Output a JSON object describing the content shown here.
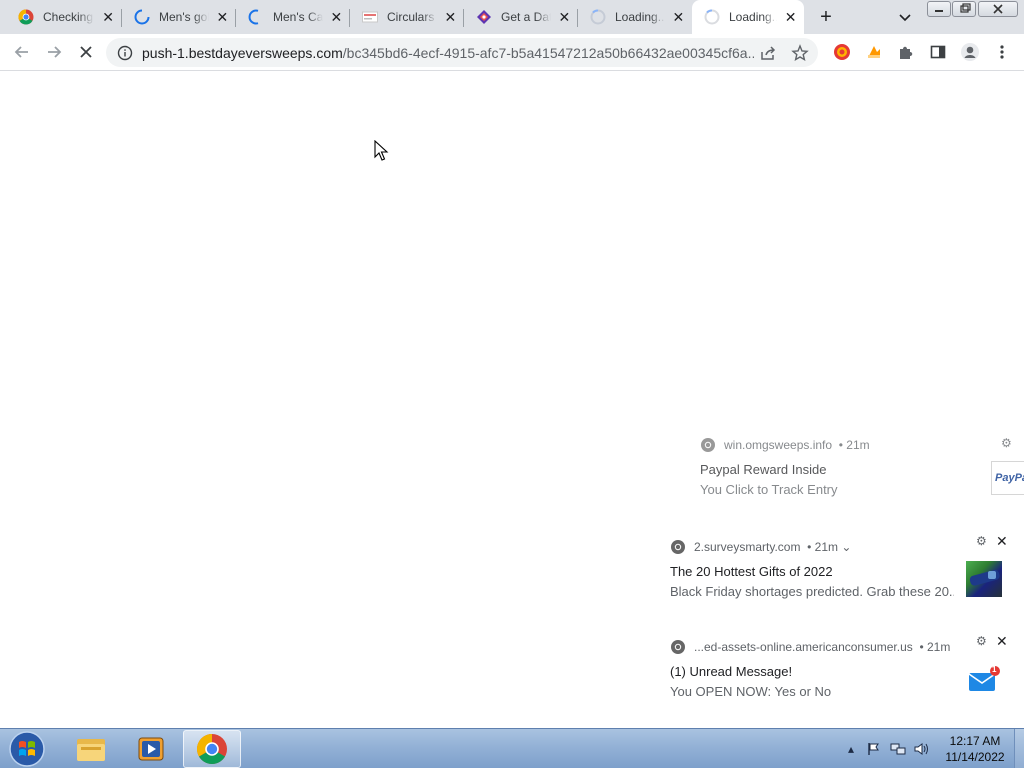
{
  "tabs": [
    {
      "title": "Checking",
      "favicon": "chrome-icon",
      "active": false
    },
    {
      "title": "Men's gold",
      "favicon": "loading-spinner-icon",
      "active": false
    },
    {
      "title": "Men's Cart",
      "favicon": "loading-spinner-icon",
      "active": false
    },
    {
      "title": "Circulars",
      "favicon": "circulars-favicon-icon",
      "active": false
    },
    {
      "title": "Get a Date",
      "favicon": "date-site-favicon-icon",
      "active": false
    },
    {
      "title": "Loading...",
      "favicon": "loading-spinner-icon",
      "active": false
    },
    {
      "title": "Loading...",
      "favicon": "loading-spinner-icon",
      "active": true
    }
  ],
  "toolbar": {
    "url_host": "push-1.bestdayeversweeps.com",
    "url_rest": "/bc345bd6-4ecf-4915-afc7-b5a41547212a50b66432ae00345cf6a...",
    "extensions": [
      "extension-red-icon",
      "extension-orange-icon",
      "puzzle-icon",
      "side-panel-icon",
      "profile-icon",
      "more-menu-icon"
    ]
  },
  "notifications": [
    {
      "source": "win.omgsweeps.info",
      "time": "• 21m",
      "title": "Paypal Reward Inside",
      "body": "You Click to Track Entry",
      "image": "PayPal",
      "partial": true
    },
    {
      "source": "2.surveysmarty.com",
      "time": "• 21m ⌄",
      "title": "The 20 Hottest Gifts of 2022",
      "body": "Black Friday shortages predicted. Grab these 20...",
      "image": "gift-photo"
    },
    {
      "source": "...ed-assets-online.americanconsumer.us",
      "time": "• 21m",
      "title": "(1) Unread Message!",
      "body": "You OPEN NOW: Yes or No",
      "image": "mail-badge",
      "badge": "1"
    }
  ],
  "taskbar": {
    "items": [
      "start-orb",
      "explorer",
      "media-player",
      "chrome"
    ],
    "time": "12:17 AM",
    "date": "11/14/2022"
  },
  "colors": {
    "tabstrip": "#dee1e6",
    "omnibox": "#f1f3f4",
    "taskbar": "#93b1d6",
    "paypal_blue": "#003087",
    "mail_blue": "#1e88e5"
  }
}
